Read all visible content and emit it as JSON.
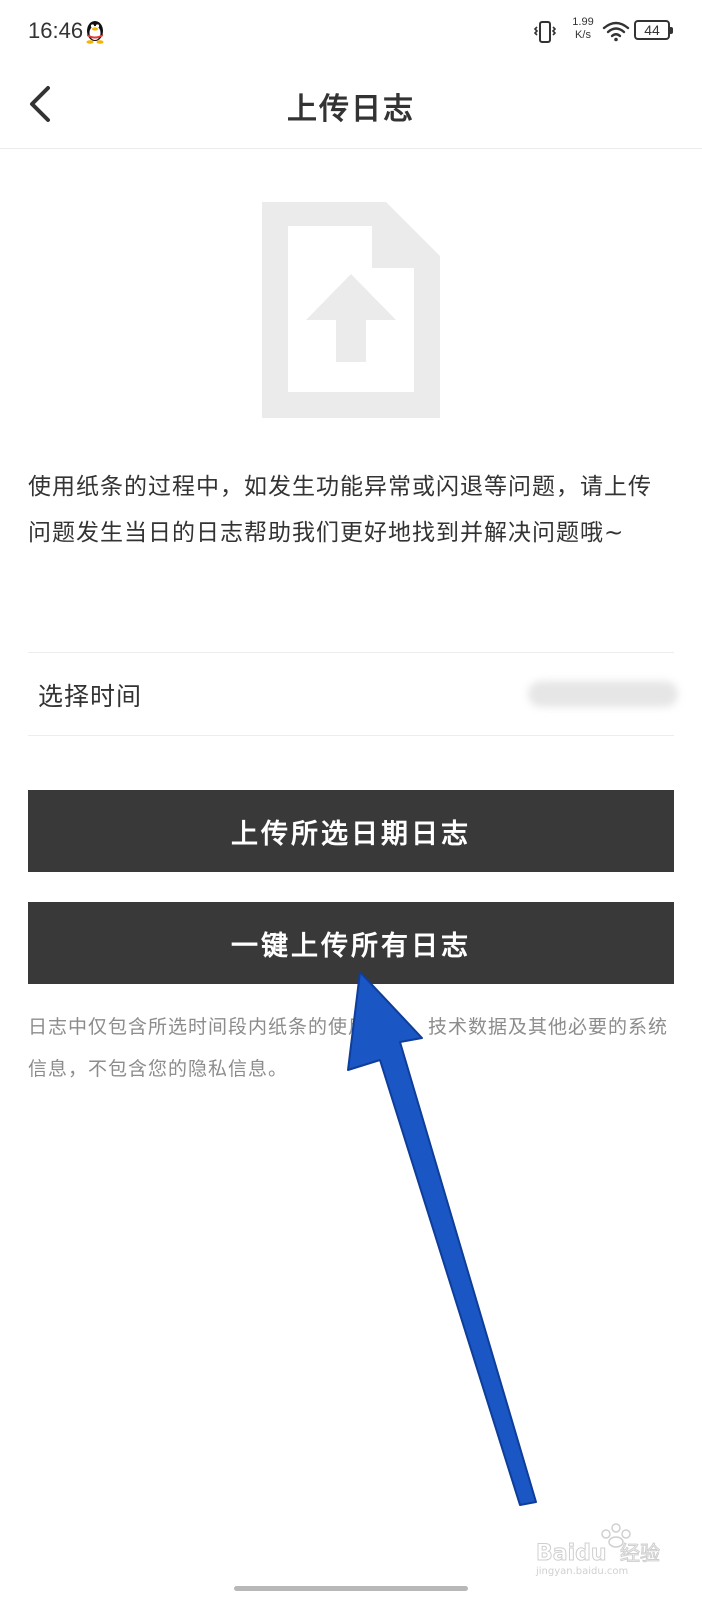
{
  "status_bar": {
    "time": "16:46",
    "net_speed_value": "1.99",
    "net_speed_unit": "K/s",
    "battery": "44",
    "icons": [
      "qq-penguin-icon",
      "vibrate-icon",
      "wifi-icon",
      "battery-icon"
    ]
  },
  "nav": {
    "title": "上传日志",
    "back_icon": "chevron-left-icon"
  },
  "hero_icon": "file-upload-icon",
  "description": "使用纸条的过程中，如发生功能异常或闪退等问题，请上传问题发生当日的日志帮助我们更好地找到并解决问题哦~",
  "time_picker": {
    "label": "选择时间"
  },
  "buttons": {
    "upload_selected": "上传所选日期日志",
    "upload_all": "一键上传所有日志"
  },
  "notice": "日志中仅包含所选时间段内纸条的使用记录、技术数据及其他必要的系统信息，不包含您的隐私信息。",
  "colors": {
    "button_bg": "#3a3939",
    "button_text": "#ffffff",
    "notice_text": "#8c8c8c",
    "annotation_arrow": "#1a56c4",
    "icon_gray": "#ebebeb"
  },
  "watermark": {
    "brand": "Baidu",
    "text": "经验",
    "url": "jingyan.baidu.com"
  }
}
